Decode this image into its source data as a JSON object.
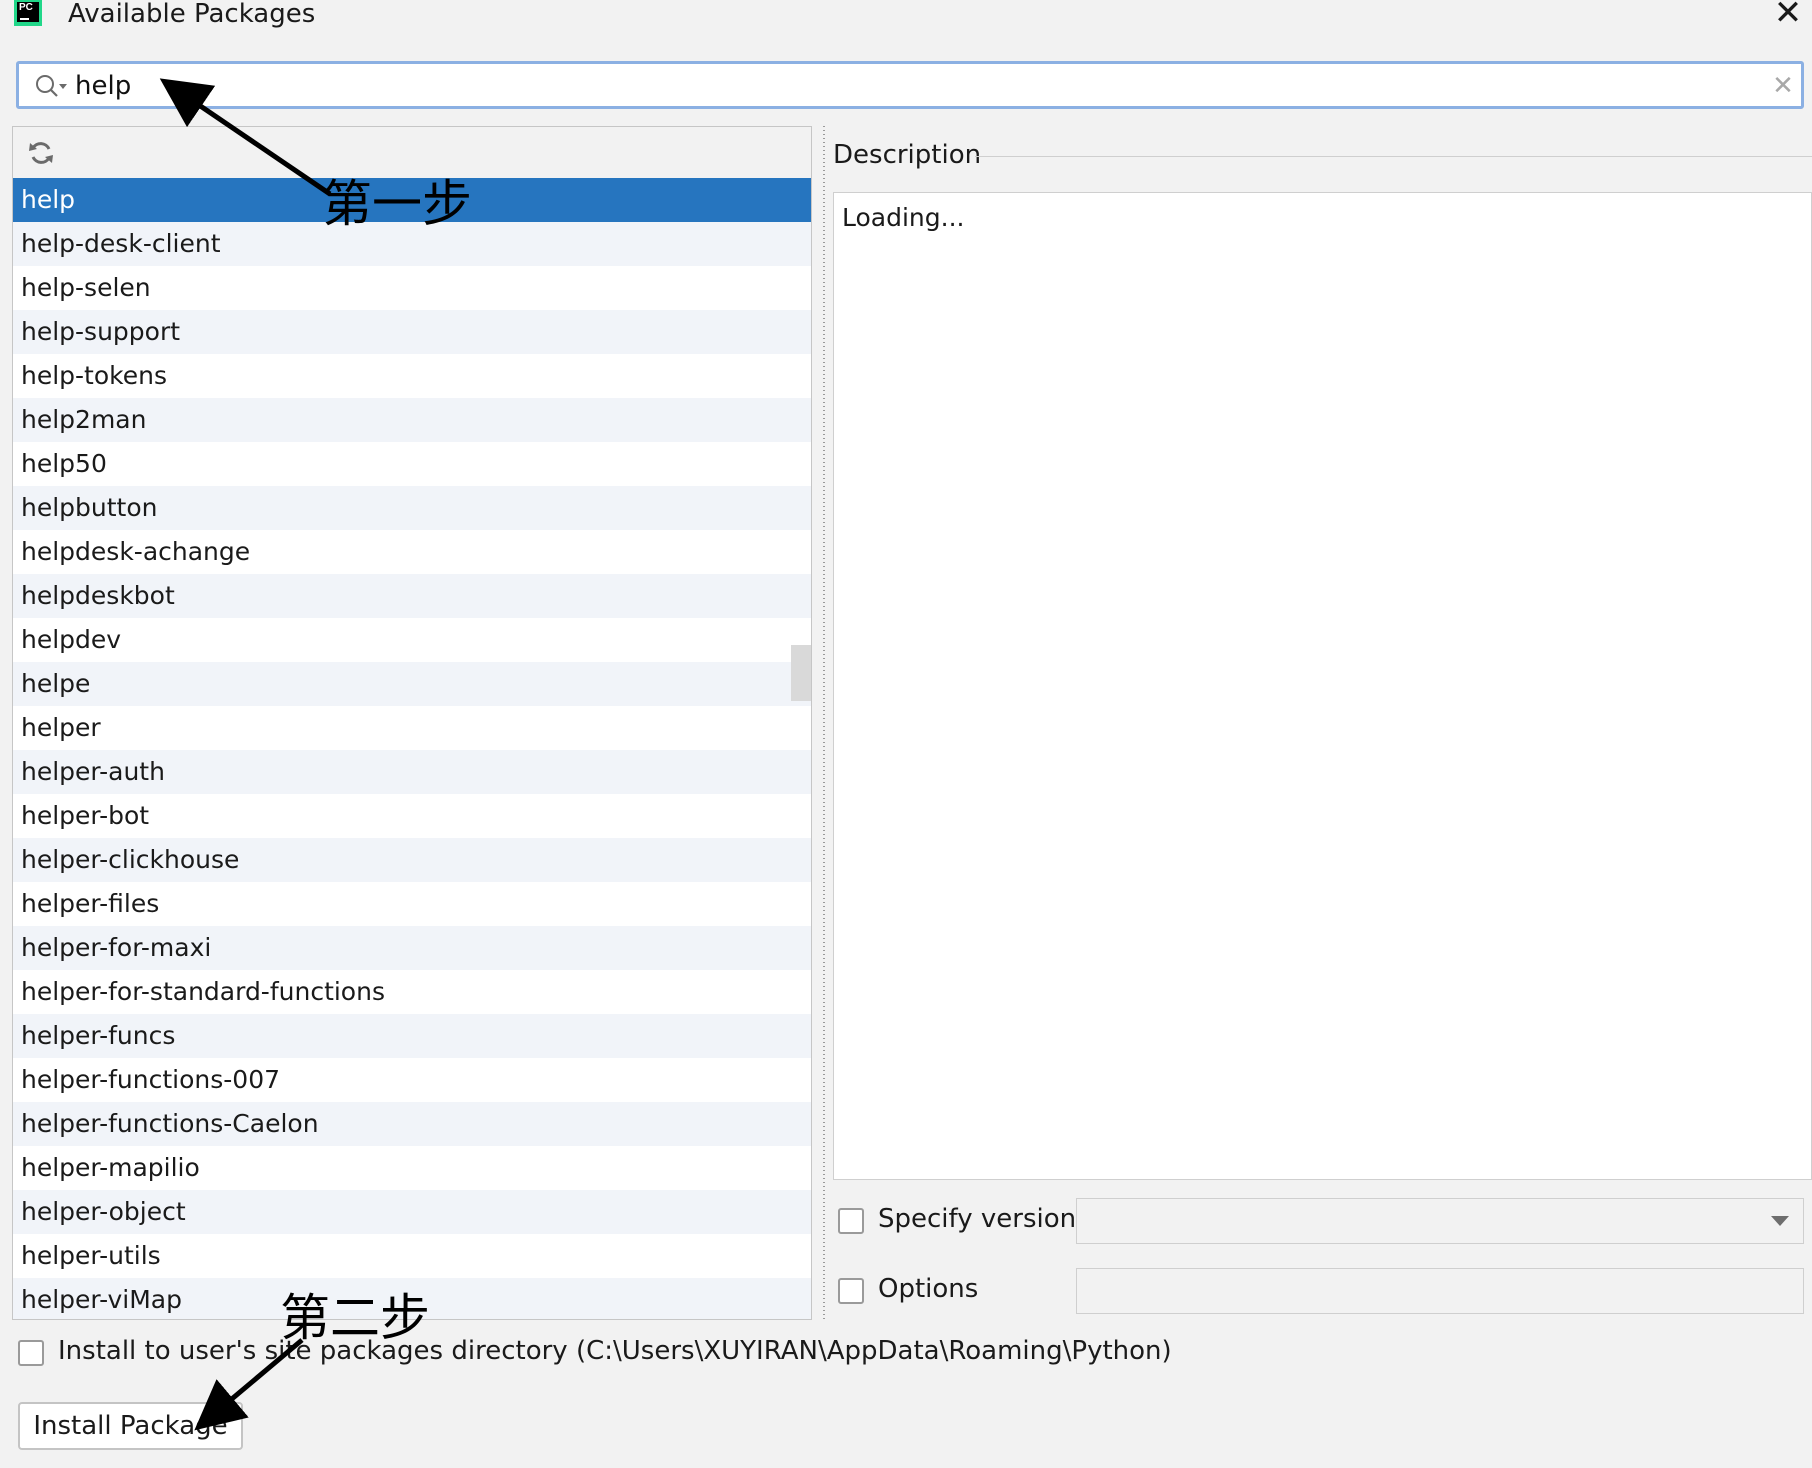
{
  "window": {
    "title": "Available Packages",
    "close_glyph": "✕",
    "app_icon_text": "PC"
  },
  "search": {
    "value": "help",
    "clear_glyph": "✕"
  },
  "packages": [
    "help",
    "help-desk-client",
    "help-selen",
    "help-support",
    "help-tokens",
    "help2man",
    "help50",
    "helpbutton",
    "helpdesk-achange",
    "helpdeskbot",
    "helpdev",
    "helpe",
    "helper",
    "helper-auth",
    "helper-bot",
    "helper-clickhouse",
    "helper-files",
    "helper-for-maxi",
    "helper-for-standard-functions",
    "helper-funcs",
    "helper-functions-007",
    "helper-functions-Caelon",
    "helper-mapilio",
    "helper-object",
    "helper-utils",
    "helper-viMap"
  ],
  "selected_package": "help",
  "description": {
    "label": "Description",
    "text": "Loading..."
  },
  "specify_version": {
    "label": "Specify version",
    "checked": false,
    "value": ""
  },
  "options": {
    "label": "Options",
    "checked": false,
    "value": ""
  },
  "install_to_user": {
    "label": "Install to user's site packages directory (C:\\Users\\XUYIRAN\\AppData\\Roaming\\Python)",
    "checked": false
  },
  "install_button": {
    "label": "Install Package"
  },
  "annotations": {
    "step1": "第一步",
    "step2": "第二步"
  },
  "colors": {
    "selection": "#2675bf",
    "search_border": "#8bb0e3",
    "window_bg": "#f2f2f2"
  }
}
